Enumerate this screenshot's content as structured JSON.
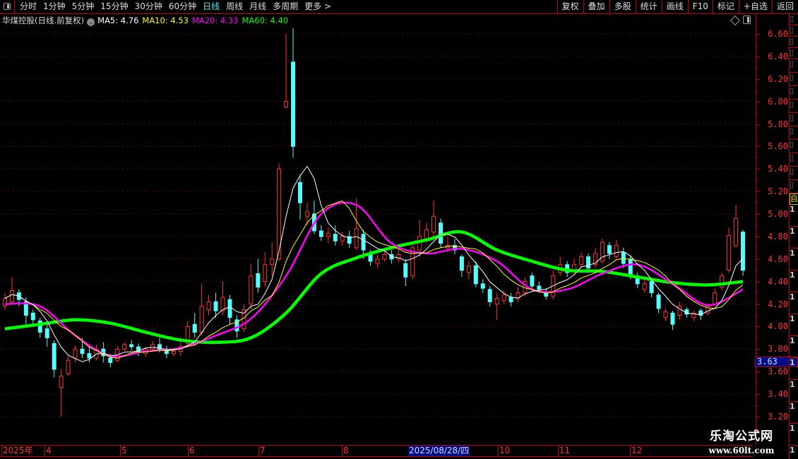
{
  "topbar": {
    "periods": [
      "分时",
      "1分钟",
      "5分钟",
      "15分钟",
      "30分钟",
      "60分钟",
      "日线",
      "周线",
      "月线",
      "多周期",
      "更多 >"
    ],
    "active_period": "日线",
    "tools": [
      "复权",
      "叠加",
      "多股",
      "统计",
      "画线",
      "F10",
      "标记",
      "+自选",
      "返回"
    ]
  },
  "info": {
    "title": "华煤控股(日线.前复权)",
    "ma5": "MA5: 4.76",
    "ma10": "MA10: 4.53",
    "ma20": "MA20: 4.33",
    "ma60": "MA60: 4.40"
  },
  "colors": {
    "up": "#ff3232",
    "down": "#54fcfc",
    "ma5": "#ffffff",
    "ma10": "#ffff00",
    "ma20": "#ff00ff",
    "ma60": "#00ff00",
    "grid": "#a00000"
  },
  "cursor_price": "3.63",
  "side_panel": {
    "auto_label": "自",
    "digits": [
      "1",
      "1",
      "1",
      "1",
      "1",
      "1",
      "1",
      "1",
      "1",
      "1",
      "1",
      "1"
    ]
  },
  "watermark": {
    "name": "乐淘公式网",
    "url": "www.60lt.com"
  },
  "chart_data": {
    "type": "candlestick",
    "y_ticks": [
      "6.60",
      "6.40",
      "6.20",
      "6.00",
      "5.80",
      "5.60",
      "5.40",
      "5.20",
      "5.00",
      "4.80",
      "4.60",
      "4.40",
      "4.20",
      "4.00",
      "3.80",
      "3.60",
      "3.40",
      "3.20"
    ],
    "ylim": [
      3.2,
      6.6
    ],
    "grid": true,
    "x_labels": [
      {
        "text": "2025年",
        "selected": false
      },
      {
        "text": "4",
        "selected": false
      },
      {
        "text": "5",
        "selected": false
      },
      {
        "text": "6",
        "selected": false
      },
      {
        "text": "7",
        "selected": false
      },
      {
        "text": "8",
        "selected": false
      },
      {
        "text": "2025/08/28/四",
        "selected": true
      },
      {
        "text": "10",
        "selected": false
      },
      {
        "text": "11",
        "selected": false
      },
      {
        "text": "12",
        "selected": false
      }
    ],
    "candles_ochl_note": "[open, close, high, low]",
    "candles": [
      [
        4.18,
        4.25,
        4.3,
        4.15
      ],
      [
        4.22,
        4.32,
        4.44,
        4.2
      ],
      [
        4.3,
        4.24,
        4.33,
        4.18
      ],
      [
        4.22,
        4.1,
        4.26,
        4.02
      ],
      [
        4.12,
        4.06,
        4.15,
        4.0
      ],
      [
        4.05,
        3.95,
        4.08,
        3.9
      ],
      [
        3.98,
        3.9,
        4.02,
        3.82
      ],
      [
        3.85,
        3.62,
        3.88,
        3.55
      ],
      [
        3.46,
        3.56,
        3.62,
        3.2
      ],
      [
        3.58,
        3.7,
        3.74,
        3.56
      ],
      [
        3.72,
        3.8,
        3.83,
        3.68
      ],
      [
        3.8,
        3.76,
        3.9,
        3.72
      ],
      [
        3.76,
        3.72,
        3.84,
        3.68
      ],
      [
        3.72,
        3.8,
        3.84,
        3.7
      ],
      [
        3.8,
        3.74,
        3.86,
        3.68
      ],
      [
        3.72,
        3.68,
        3.76,
        3.64
      ],
      [
        3.7,
        3.8,
        3.83,
        3.68
      ],
      [
        3.8,
        3.84,
        3.86,
        3.78
      ],
      [
        3.84,
        3.82,
        3.88,
        3.79
      ],
      [
        3.82,
        3.78,
        3.85,
        3.74
      ],
      [
        3.76,
        3.8,
        3.82,
        3.73
      ],
      [
        3.8,
        3.84,
        3.87,
        3.78
      ],
      [
        3.84,
        3.8,
        3.9,
        3.77
      ],
      [
        3.8,
        3.76,
        3.83,
        3.72
      ],
      [
        3.76,
        3.78,
        3.8,
        3.74
      ],
      [
        3.78,
        3.82,
        3.9,
        3.74
      ],
      [
        3.85,
        4.0,
        4.05,
        3.82
      ],
      [
        4.02,
        3.95,
        4.12,
        3.9
      ],
      [
        3.95,
        4.18,
        4.38,
        3.92
      ],
      [
        4.15,
        4.22,
        4.28,
        4.1
      ],
      [
        4.22,
        4.14,
        4.3,
        4.08
      ],
      [
        4.14,
        4.26,
        4.4,
        4.1
      ],
      [
        4.24,
        4.08,
        4.28,
        4.02
      ],
      [
        4.06,
        3.96,
        4.1,
        3.9
      ],
      [
        3.98,
        4.15,
        4.2,
        3.95
      ],
      [
        4.2,
        4.45,
        4.55,
        4.15
      ],
      [
        4.47,
        4.35,
        4.6,
        4.3
      ],
      [
        4.4,
        4.55,
        4.66,
        4.35
      ],
      [
        4.55,
        4.6,
        4.75,
        4.45
      ],
      [
        4.6,
        5.4,
        5.45,
        4.58
      ],
      [
        5.95,
        6.0,
        6.6,
        5.94
      ],
      [
        6.35,
        5.6,
        6.65,
        5.5
      ],
      [
        5.28,
        5.1,
        5.35,
        4.95
      ],
      [
        4.98,
        5.02,
        5.1,
        4.9
      ],
      [
        5.0,
        4.85,
        5.12,
        4.82
      ],
      [
        4.85,
        4.8,
        4.9,
        4.76
      ],
      [
        4.8,
        4.83,
        4.88,
        4.74
      ],
      [
        4.82,
        4.76,
        4.9,
        4.72
      ],
      [
        4.76,
        4.8,
        4.84,
        4.72
      ],
      [
        4.8,
        4.74,
        4.85,
        4.7
      ],
      [
        4.7,
        4.87,
        5.14,
        4.68
      ],
      [
        4.82,
        4.68,
        4.86,
        4.6
      ],
      [
        4.64,
        4.58,
        4.68,
        4.54
      ],
      [
        4.56,
        4.6,
        4.64,
        4.52
      ],
      [
        4.6,
        4.64,
        4.7,
        4.58
      ],
      [
        4.64,
        4.6,
        4.68,
        4.56
      ],
      [
        4.6,
        4.64,
        4.7,
        4.57
      ],
      [
        4.56,
        4.44,
        4.6,
        4.36
      ],
      [
        4.45,
        4.7,
        4.74,
        4.42
      ],
      [
        4.68,
        4.8,
        4.95,
        4.62
      ],
      [
        4.78,
        4.86,
        4.92,
        4.74
      ],
      [
        4.84,
        4.98,
        5.12,
        4.8
      ],
      [
        4.92,
        4.74,
        4.96,
        4.7
      ],
      [
        4.7,
        4.72,
        4.8,
        4.66
      ],
      [
        4.72,
        4.68,
        4.78,
        4.64
      ],
      [
        4.62,
        4.5,
        4.64,
        4.44
      ],
      [
        4.48,
        4.54,
        4.58,
        4.42
      ],
      [
        4.54,
        4.38,
        4.58,
        4.35
      ],
      [
        4.38,
        4.34,
        4.42,
        4.3
      ],
      [
        4.33,
        4.22,
        4.36,
        4.18
      ],
      [
        4.2,
        4.25,
        4.3,
        4.06
      ],
      [
        4.23,
        4.28,
        4.32,
        4.2
      ],
      [
        4.26,
        4.22,
        4.3,
        4.18
      ],
      [
        4.25,
        4.3,
        4.35,
        4.22
      ],
      [
        4.3,
        4.4,
        4.44,
        4.27
      ],
      [
        4.45,
        4.36,
        4.48,
        4.32
      ],
      [
        4.36,
        4.33,
        4.4,
        4.3
      ],
      [
        4.31,
        4.27,
        4.34,
        4.24
      ],
      [
        4.27,
        4.45,
        4.5,
        4.24
      ],
      [
        4.48,
        4.55,
        4.62,
        4.45
      ],
      [
        4.55,
        4.48,
        4.58,
        4.44
      ],
      [
        4.5,
        4.55,
        4.6,
        4.46
      ],
      [
        4.55,
        4.62,
        4.66,
        4.52
      ],
      [
        4.62,
        4.52,
        4.65,
        4.48
      ],
      [
        4.55,
        4.65,
        4.7,
        4.52
      ],
      [
        4.58,
        4.75,
        4.78,
        4.56
      ],
      [
        4.72,
        4.65,
        4.75,
        4.6
      ],
      [
        4.62,
        4.72,
        4.77,
        4.6
      ],
      [
        4.66,
        4.56,
        4.7,
        4.52
      ],
      [
        4.6,
        4.46,
        4.63,
        4.42
      ],
      [
        4.45,
        4.38,
        4.48,
        4.34
      ],
      [
        4.33,
        4.38,
        4.42,
        4.3
      ],
      [
        4.4,
        4.3,
        4.42,
        4.26
      ],
      [
        4.28,
        4.16,
        4.3,
        4.12
      ],
      [
        4.08,
        4.13,
        4.16,
        4.05
      ],
      [
        4.12,
        4.02,
        4.14,
        3.97
      ],
      [
        4.1,
        4.18,
        4.22,
        4.06
      ],
      [
        4.15,
        4.11,
        4.17,
        4.08
      ],
      [
        4.08,
        4.12,
        4.14,
        4.05
      ],
      [
        4.14,
        4.1,
        4.16,
        4.06
      ],
      [
        4.12,
        4.18,
        4.2,
        4.1
      ],
      [
        4.2,
        4.3,
        4.34,
        4.18
      ],
      [
        4.35,
        4.45,
        4.48,
        4.32
      ],
      [
        4.5,
        4.81,
        4.88,
        4.48
      ],
      [
        4.72,
        4.96,
        5.08,
        4.7
      ],
      [
        4.84,
        4.5,
        4.86,
        4.45
      ]
    ],
    "ma20_every5": [
      4.2,
      4.18,
      3.92,
      3.74,
      3.78,
      3.81,
      3.92,
      4.07,
      4.45,
      5.0,
      5.08,
      4.74,
      4.65,
      4.69,
      4.58,
      4.33,
      4.33,
      4.47,
      4.55,
      4.38,
      4.19,
      4.33
    ],
    "ma60_every5": [
      3.98,
      4.02,
      4.06,
      4.03,
      3.95,
      3.88,
      3.86,
      3.9,
      4.12,
      4.47,
      4.61,
      4.7,
      4.77,
      4.84,
      4.68,
      4.58,
      4.5,
      4.49,
      4.44,
      4.39,
      4.37,
      4.4
    ]
  }
}
